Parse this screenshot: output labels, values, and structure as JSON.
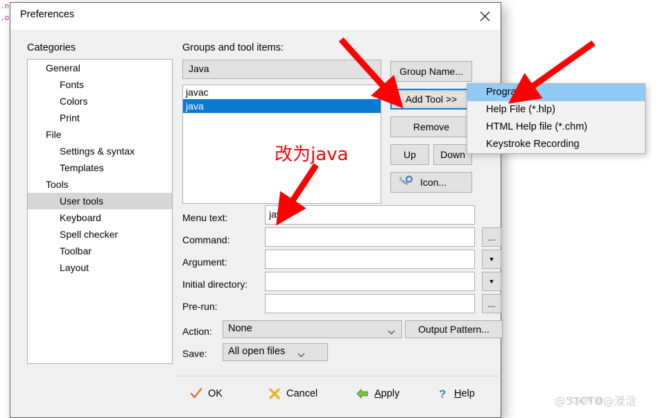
{
  "background": {
    "line1": ".n",
    "line2": ".o"
  },
  "dialog": {
    "title": "Preferences",
    "close_icon": "close-icon"
  },
  "categories": {
    "label": "Categories",
    "items": [
      {
        "label": "General",
        "level": 0,
        "selected": false
      },
      {
        "label": "Fonts",
        "level": 1,
        "selected": false
      },
      {
        "label": "Colors",
        "level": 1,
        "selected": false
      },
      {
        "label": "Print",
        "level": 1,
        "selected": false
      },
      {
        "label": "File",
        "level": 0,
        "selected": false
      },
      {
        "label": "Settings & syntax",
        "level": 1,
        "selected": false
      },
      {
        "label": "Templates",
        "level": 1,
        "selected": false
      },
      {
        "label": "Tools",
        "level": 0,
        "selected": false
      },
      {
        "label": "User tools",
        "level": 1,
        "selected": true
      },
      {
        "label": "Keyboard",
        "level": 1,
        "selected": false
      },
      {
        "label": "Spell checker",
        "level": 1,
        "selected": false
      },
      {
        "label": "Toolbar",
        "level": 1,
        "selected": false
      },
      {
        "label": "Layout",
        "level": 1,
        "selected": false
      }
    ]
  },
  "groups": {
    "label": "Groups and tool items:",
    "group_value": "Java",
    "tools": [
      {
        "label": "javac",
        "selected": false
      },
      {
        "label": "java",
        "selected": true
      }
    ]
  },
  "buttons": {
    "group_name": "Group Name...",
    "add_tool": "Add Tool >>",
    "remove": "Remove",
    "up": "Up",
    "down": "Down",
    "icon": "Icon...",
    "output_pattern": "Output Pattern..."
  },
  "form": {
    "menu_text": {
      "label": "Menu text:",
      "value": "java"
    },
    "command": {
      "label": "Command:",
      "value": "",
      "side": "..."
    },
    "argument": {
      "label": "Argument:",
      "value": "",
      "side": "▼"
    },
    "initial_directory": {
      "label": "Initial directory:",
      "value": "",
      "side": "▼"
    },
    "pre_run": {
      "label": "Pre-run:",
      "value": "",
      "side": "..."
    },
    "action": {
      "label": "Action:",
      "value": "None"
    },
    "save": {
      "label": "Save:",
      "value": "All open files"
    }
  },
  "popup_menu": {
    "items": [
      {
        "label": "Program",
        "selected": true
      },
      {
        "label": "Help File (*.hlp)",
        "selected": false
      },
      {
        "label": "HTML Help file (*.chm)",
        "selected": false
      },
      {
        "label": "Keystroke Recording",
        "selected": false
      }
    ]
  },
  "footer": {
    "ok": "OK",
    "cancel": "Cancel",
    "apply_pre": "A",
    "apply_post": "pply",
    "help_pre": "H",
    "help_post": "elp"
  },
  "annotations": {
    "note": "改为java",
    "arrow_color": "#ff0000"
  },
  "watermark": {
    "top": "@51CTO@漇浛",
    "bottom": "CSDN @"
  },
  "colors": {
    "selection_blue": "#0a7ad1",
    "menu_highlight": "#90caf5",
    "focus_ring": "#0a7ad1",
    "category_selected": "#d6d6d6",
    "dialog_bg": "#f0f0f0"
  }
}
